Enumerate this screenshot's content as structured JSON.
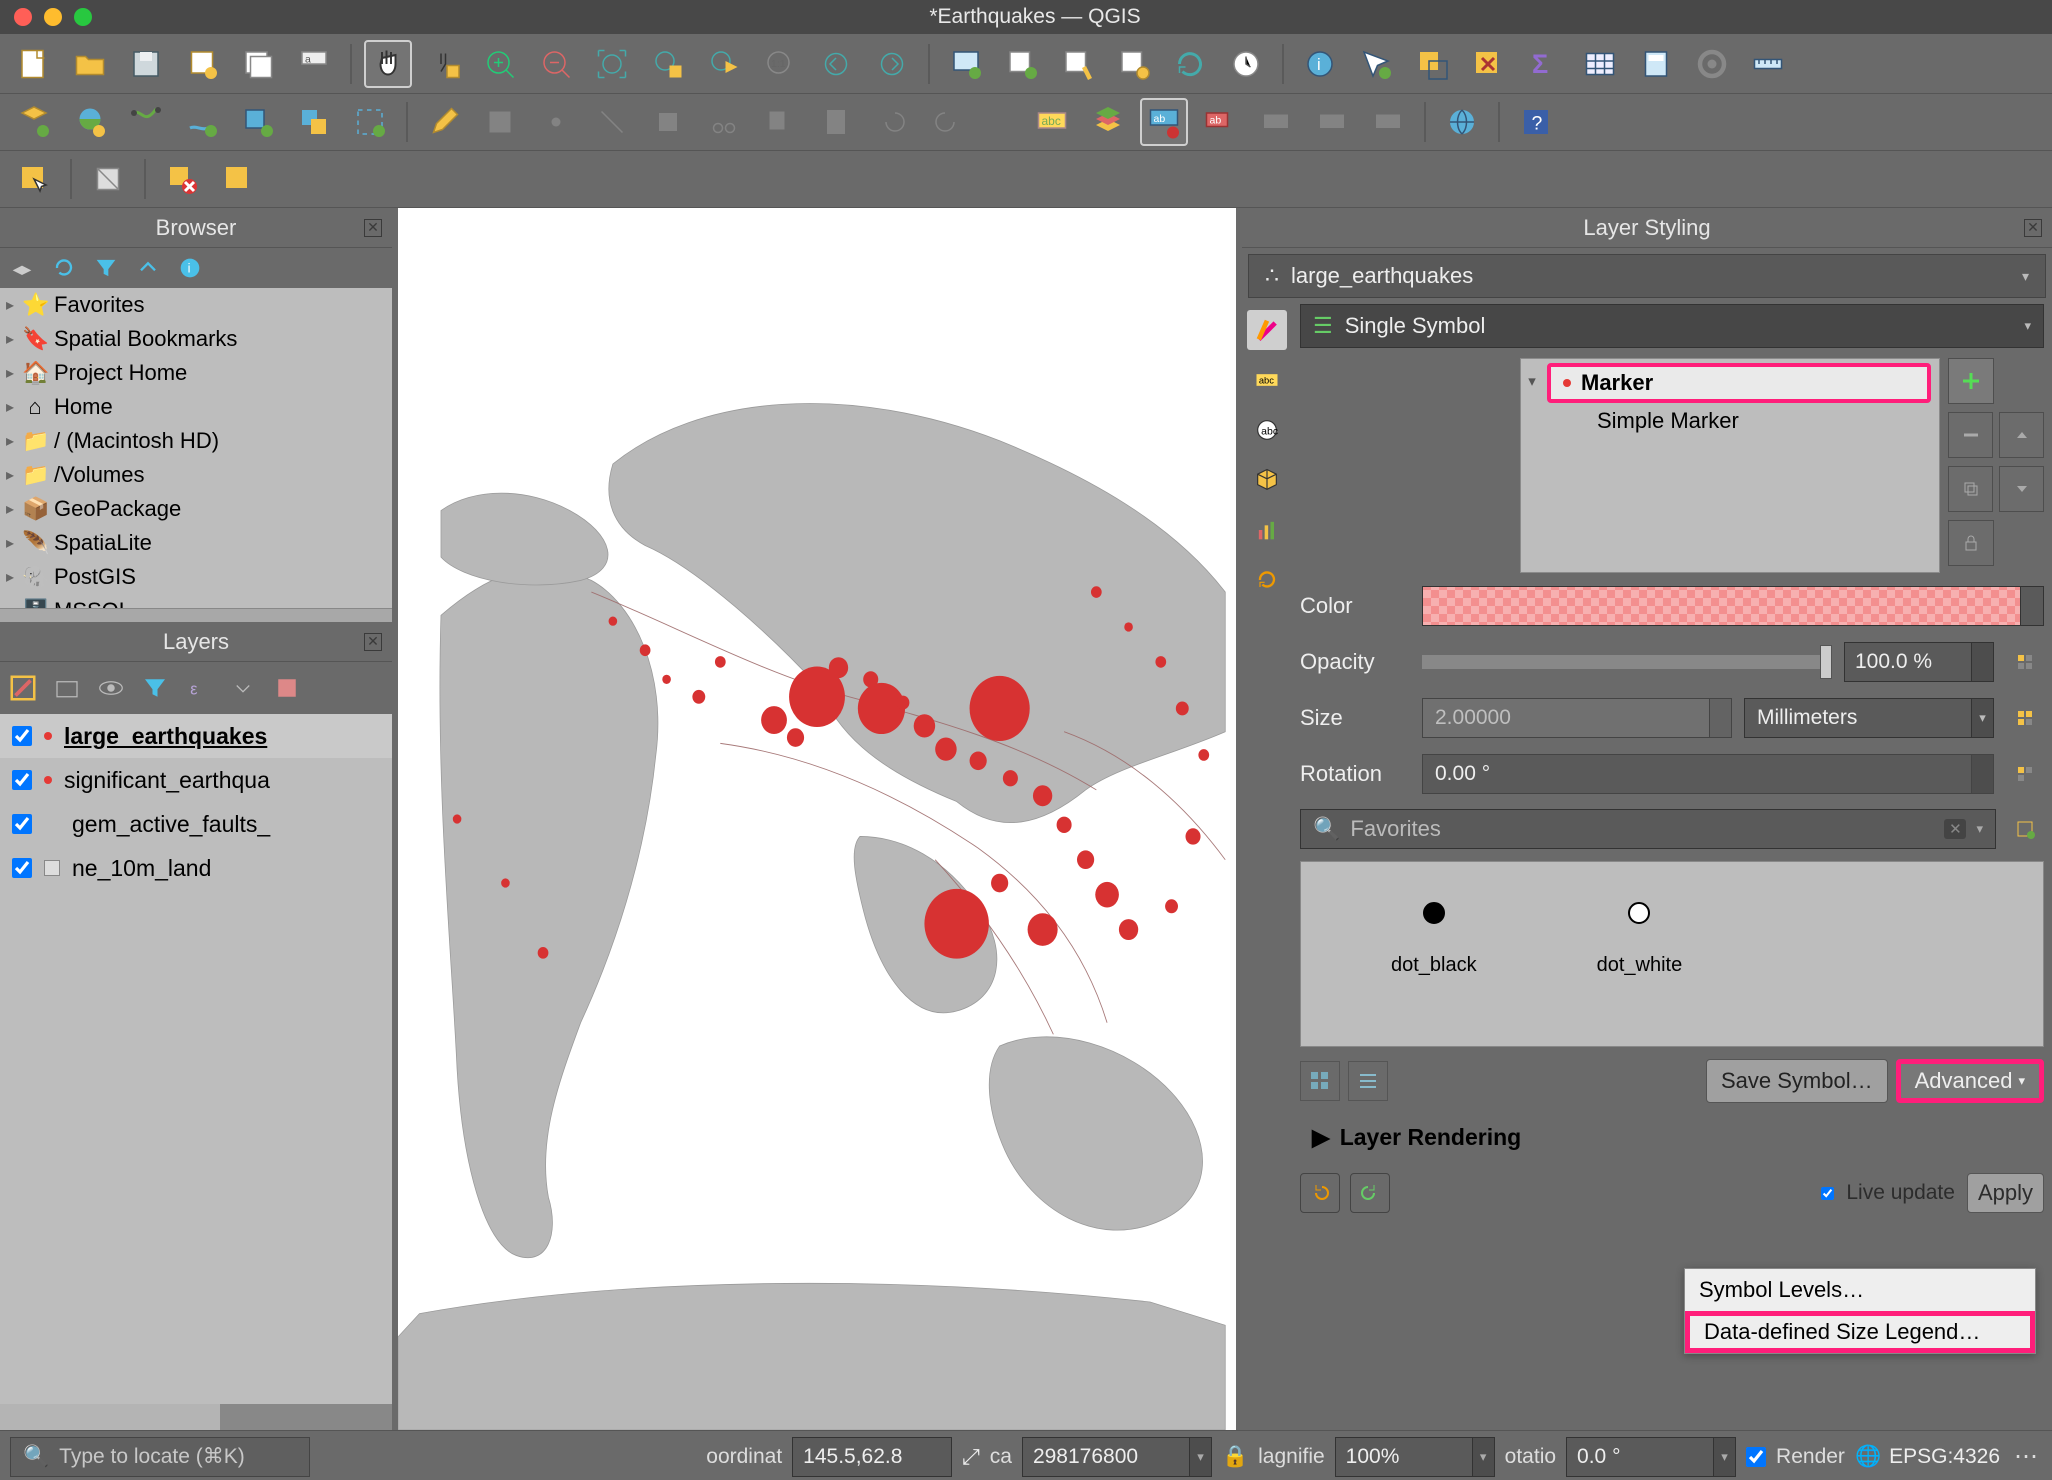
{
  "app": {
    "title": "*Earthquakes — QGIS"
  },
  "browser": {
    "title": "Browser",
    "items": [
      {
        "icon": "star",
        "label": "Favorites"
      },
      {
        "icon": "bookmark",
        "label": "Spatial Bookmarks"
      },
      {
        "icon": "home-proj",
        "label": "Project Home"
      },
      {
        "icon": "home",
        "label": "Home"
      },
      {
        "icon": "folder",
        "label": "/ (Macintosh HD)"
      },
      {
        "icon": "folder",
        "label": "/Volumes"
      },
      {
        "icon": "gpkg",
        "label": "GeoPackage"
      },
      {
        "icon": "spatialite",
        "label": "SpatiaLite"
      },
      {
        "icon": "postgis",
        "label": "PostGIS"
      },
      {
        "icon": "mssql",
        "label": "MSSQL"
      }
    ]
  },
  "layers": {
    "title": "Layers",
    "items": [
      {
        "checked": true,
        "name": "large_earthquakes",
        "active": true,
        "swatch": "dot"
      },
      {
        "checked": true,
        "name": "significant_earthqua",
        "active": false,
        "swatch": "dot"
      },
      {
        "checked": true,
        "name": "gem_active_faults_",
        "active": false,
        "swatch": "none"
      },
      {
        "checked": true,
        "name": "ne_10m_land",
        "active": false,
        "swatch": "box"
      }
    ]
  },
  "layer_styling": {
    "title": "Layer Styling",
    "layer": "large_earthquakes",
    "symbol_mode": "Single Symbol",
    "marker_tree": {
      "root": "Marker",
      "child": "Simple Marker"
    },
    "color_label": "Color",
    "opacity_label": "Opacity",
    "opacity_value": "100.0 %",
    "size_label": "Size",
    "size_value": "2.00000",
    "size_unit": "Millimeters",
    "rotation_label": "Rotation",
    "rotation_value": "0.00 °",
    "favorites_placeholder": "Favorites",
    "fav_items": [
      {
        "name": "dot_black",
        "fill": "#000"
      },
      {
        "name": "dot_white",
        "fill": "#fff"
      }
    ],
    "save_symbol": "Save Symbol…",
    "advanced": "Advanced",
    "rendering": "Layer Rendering",
    "live_update": "Live update",
    "apply": "Apply",
    "adv_menu": [
      "Symbol Levels…",
      "Data-defined Size Legend…"
    ]
  },
  "status": {
    "locate_placeholder": "Type to locate (⌘K)",
    "coord_label": "oordinat",
    "coord_value": "145.5,62.8",
    "scale_label": "ca",
    "scale_value": "298176800",
    "magnifier_label": "lagnifie",
    "magnifier_value": "100%",
    "rotation_label": "otatio",
    "rotation_value": "0.0 °",
    "render_label": "Render",
    "crs": "EPSG:4326"
  }
}
